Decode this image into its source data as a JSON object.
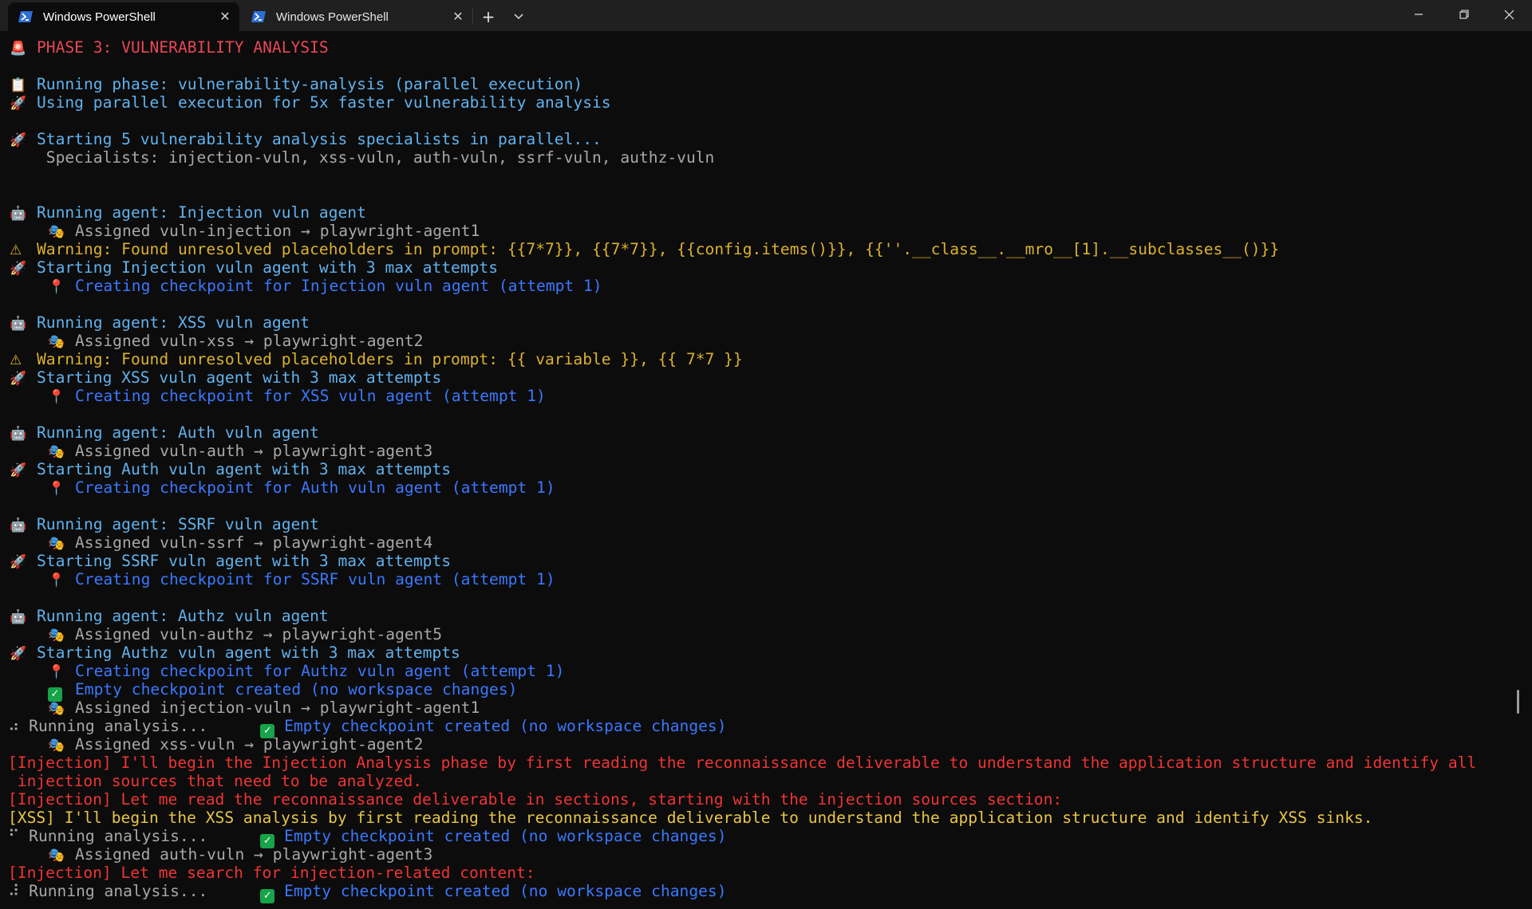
{
  "window": {
    "tabs": [
      {
        "label": "Windows PowerShell",
        "active": true,
        "icon": "powershell-icon"
      },
      {
        "label": "Windows PowerShell",
        "active": false,
        "icon": "powershell-icon"
      }
    ],
    "new_tab": "+",
    "tab_menu": "⌄",
    "controls": {
      "minimize": "—",
      "restore": "❐",
      "close": "✕"
    }
  },
  "colors": {
    "background": "#0c0c0c",
    "titlebar": "#202020",
    "phase_red": "#e74856",
    "cyan": "#3a96dd",
    "gray": "#a8a8a8",
    "warning_yellow": "#dcb12d",
    "checkpoint_blue": "#3b78ff",
    "error_red": "#f03434"
  },
  "terminal": {
    "lines": [
      {
        "icon": "🚨",
        "icon_name": "alarm-light-icon",
        "text": "PHASE 3: VULNERABILITY ANALYSIS",
        "color": "c-red",
        "indent": false
      },
      {
        "icon": "📋",
        "icon_name": "clipboard-icon",
        "text": "Running phase: vulnerability-analysis (parallel execution)",
        "color": "c-cyanb",
        "indent": false
      },
      {
        "icon": "🚀",
        "icon_name": "rocket-icon",
        "text": "Using parallel execution for 5x faster vulnerability analysis",
        "color": "c-cyanb",
        "indent": false
      },
      {
        "icon": "🚀",
        "icon_name": "rocket-icon",
        "text": "Starting 5 vulnerability analysis specialists in parallel...",
        "color": "c-cyanb",
        "indent": false
      },
      {
        "icon": "",
        "icon_name": "",
        "text": " Specialists: injection-vuln, xss-vuln, auth-vuln, ssrf-vuln, authz-vuln",
        "color": "c-gray",
        "indent": false
      },
      {
        "icon": "🤖",
        "icon_name": "robot-icon",
        "text": "Running agent: Injection vuln agent",
        "color": "c-cyanb",
        "indent": false
      },
      {
        "icon": "🎭",
        "icon_name": "theater-masks-icon",
        "text": "Assigned vuln-injection → playwright-agent1",
        "color": "c-gray",
        "indent": true
      },
      {
        "icon": "⚠",
        "icon_name": "warning-icon",
        "text": "Warning: Found unresolved placeholders in prompt: {{7*7}}, {{7*7}}, {{config.items()}}, {{''.__class__.__mro__[1].__subclasses__()}}",
        "color": "c-yellow",
        "indent": false
      },
      {
        "icon": "🚀",
        "icon_name": "rocket-icon",
        "text": "Starting Injection vuln agent with 3 max attempts",
        "color": "c-cyanb",
        "indent": false
      },
      {
        "icon": "📍",
        "icon_name": "pin-icon",
        "text": "Creating checkpoint for Injection vuln agent (attempt 1)",
        "color": "c-blue",
        "indent": true
      },
      {
        "icon": "🤖",
        "icon_name": "robot-icon",
        "text": "Running agent: XSS vuln agent",
        "color": "c-cyanb",
        "indent": false
      },
      {
        "icon": "🎭",
        "icon_name": "theater-masks-icon",
        "text": "Assigned vuln-xss → playwright-agent2",
        "color": "c-gray",
        "indent": true
      },
      {
        "icon": "⚠",
        "icon_name": "warning-icon",
        "text": "Warning: Found unresolved placeholders in prompt: {{ variable }}, {{ 7*7 }}",
        "color": "c-yellow",
        "indent": false
      },
      {
        "icon": "🚀",
        "icon_name": "rocket-icon",
        "text": "Starting XSS vuln agent with 3 max attempts",
        "color": "c-cyanb",
        "indent": false
      },
      {
        "icon": "📍",
        "icon_name": "pin-icon",
        "text": "Creating checkpoint for XSS vuln agent (attempt 1)",
        "color": "c-blue",
        "indent": true
      },
      {
        "icon": "🤖",
        "icon_name": "robot-icon",
        "text": "Running agent: Auth vuln agent",
        "color": "c-cyanb",
        "indent": false
      },
      {
        "icon": "🎭",
        "icon_name": "theater-masks-icon",
        "text": "Assigned vuln-auth → playwright-agent3",
        "color": "c-gray",
        "indent": true
      },
      {
        "icon": "🚀",
        "icon_name": "rocket-icon",
        "text": "Starting Auth vuln agent with 3 max attempts",
        "color": "c-cyanb",
        "indent": false
      },
      {
        "icon": "📍",
        "icon_name": "pin-icon",
        "text": "Creating checkpoint for Auth vuln agent (attempt 1)",
        "color": "c-blue",
        "indent": true
      },
      {
        "icon": "🤖",
        "icon_name": "robot-icon",
        "text": "Running agent: SSRF vuln agent",
        "color": "c-cyanb",
        "indent": false
      },
      {
        "icon": "🎭",
        "icon_name": "theater-masks-icon",
        "text": "Assigned vuln-ssrf → playwright-agent4",
        "color": "c-gray",
        "indent": true
      },
      {
        "icon": "🚀",
        "icon_name": "rocket-icon",
        "text": "Starting SSRF vuln agent with 3 max attempts",
        "color": "c-cyanb",
        "indent": false
      },
      {
        "icon": "📍",
        "icon_name": "pin-icon",
        "text": "Creating checkpoint for SSRF vuln agent (attempt 1)",
        "color": "c-blue",
        "indent": true
      },
      {
        "icon": "🤖",
        "icon_name": "robot-icon",
        "text": "Running agent: Authz vuln agent",
        "color": "c-cyanb",
        "indent": false
      },
      {
        "icon": "🎭",
        "icon_name": "theater-masks-icon",
        "text": "Assigned vuln-authz → playwright-agent5",
        "color": "c-gray",
        "indent": true
      },
      {
        "icon": "🚀",
        "icon_name": "rocket-icon",
        "text": "Starting Authz vuln agent with 3 max attempts",
        "color": "c-cyanb",
        "indent": false
      },
      {
        "icon": "📍",
        "icon_name": "pin-icon",
        "text": "Creating checkpoint for Authz vuln agent (attempt 1)",
        "color": "c-blue",
        "indent": true
      },
      {
        "icon": "✓",
        "icon_name": "check-box-icon",
        "text": "Empty checkpoint created (no workspace changes)",
        "color": "c-blue",
        "indent": true
      },
      {
        "icon": "🎭",
        "icon_name": "theater-masks-icon",
        "text": "Assigned injection-vuln → playwright-agent1",
        "color": "c-gray",
        "indent": true
      }
    ],
    "running_analysis": "Running analysis...",
    "spinners": [
      "⠴",
      "⠋",
      "⠼"
    ],
    "empty_checkpoint": "Empty checkpoint created (no workspace changes)",
    "assigned_xss": "Assigned xss-vuln → playwright-agent2",
    "assigned_auth": "Assigned auth-vuln → playwright-agent3",
    "injection_msg_1": "[Injection] I'll begin the Injection Analysis phase by first reading the reconnaissance deliverable to understand the application structure and identify all",
    "injection_msg_1b": " injection sources that need to be analyzed.",
    "injection_msg_2": "[Injection] Let me read the reconnaissance deliverable in sections, starting with the injection sources section:",
    "xss_msg": "[XSS] I'll begin the XSS analysis by first reading the reconnaissance deliverable to understand the application structure and identify XSS sinks.",
    "injection_msg_3": "[Injection] Let me search for injection-related content:"
  }
}
